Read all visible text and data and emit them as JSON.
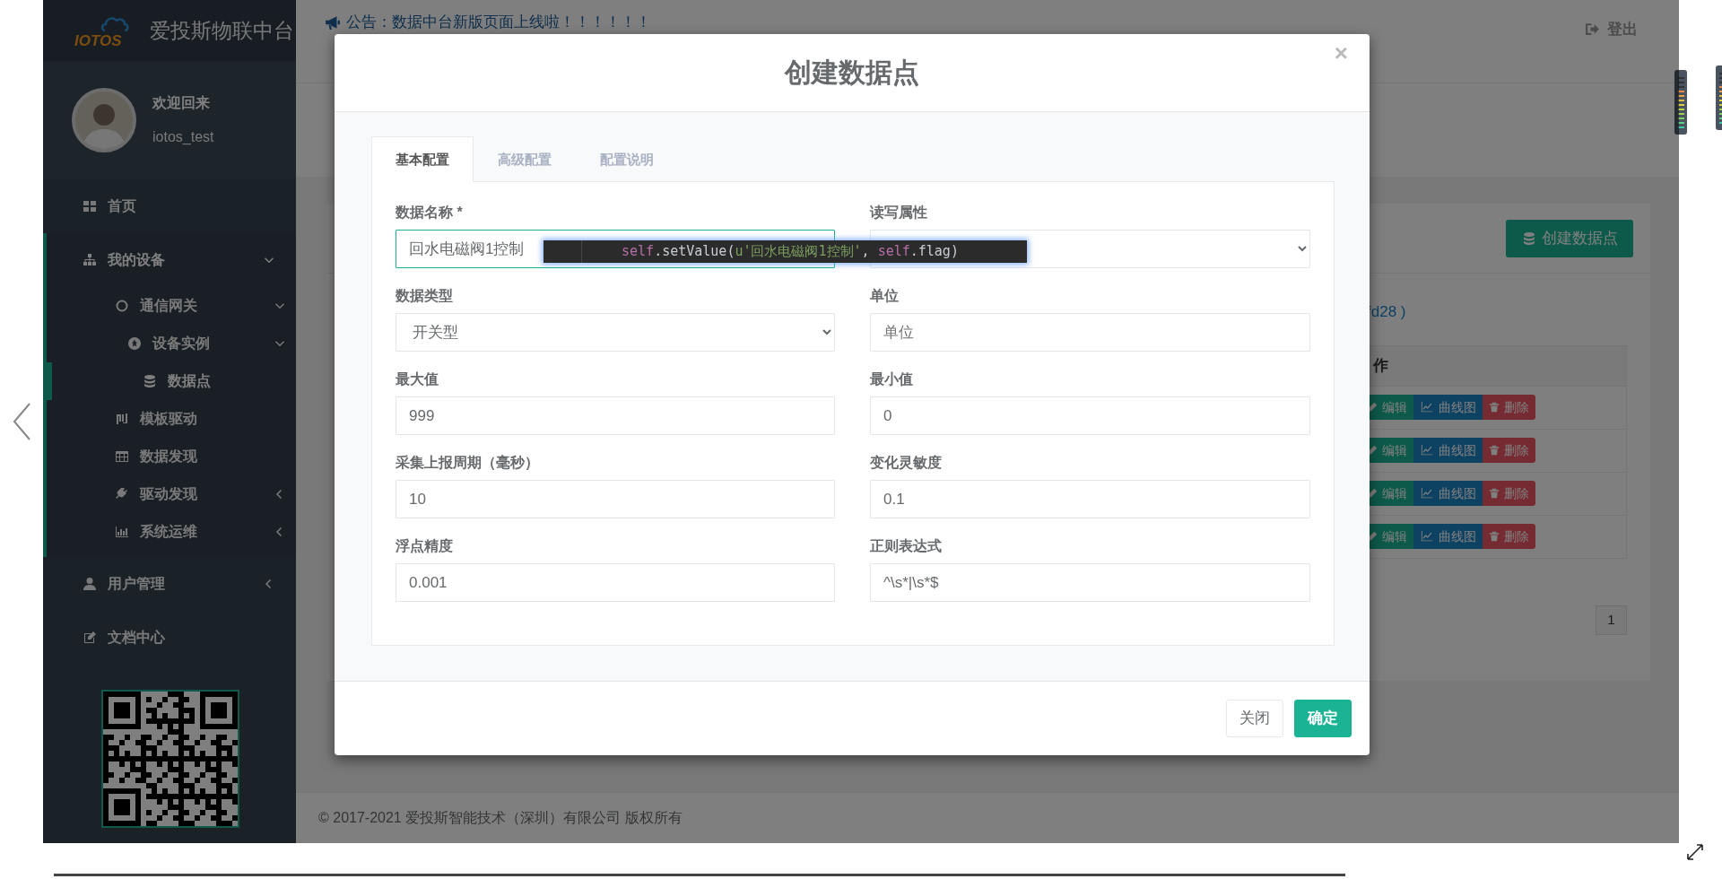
{
  "sidebar": {
    "logo_text": "IOTOS",
    "title": "爱投斯物联中台",
    "greeting": "欢迎回来",
    "username": "iotos_test",
    "menu": [
      {
        "label": "首页",
        "selected": false
      },
      {
        "label": "我的设备",
        "selected": true,
        "expanded": true,
        "children": [
          {
            "label": "通信网关",
            "selected": false,
            "expanded": true,
            "children": [
              {
                "label": "设备实例",
                "selected": false,
                "expanded": true,
                "children": [
                  {
                    "label": "数据点",
                    "selected": true
                  }
                ]
              }
            ]
          },
          {
            "label": "模板驱动",
            "selected": false
          },
          {
            "label": "数据发现",
            "selected": false
          },
          {
            "label": "驱动发现",
            "selected": false,
            "expanded": false
          },
          {
            "label": "系统运维",
            "selected": false,
            "expanded": false
          }
        ]
      },
      {
        "label": "用户管理",
        "selected": false,
        "expanded": false
      },
      {
        "label": "文档中心",
        "selected": false
      }
    ]
  },
  "header": {
    "announcement": "公告：数据中台新版页面上线啦！！！！！！",
    "logout": "登出"
  },
  "background_card": {
    "create_button": "创建数据点",
    "info_text": "fd28 )",
    "table": {
      "action_header": "作",
      "rows": [
        {
          "edit": "编辑",
          "chart": "曲线图",
          "delete": "删除"
        },
        {
          "edit": "编辑",
          "chart": "曲线图",
          "delete": "删除"
        },
        {
          "edit": "编辑",
          "chart": "曲线图",
          "delete": "删除"
        },
        {
          "edit": "编辑",
          "chart": "曲线图",
          "delete": "删除"
        }
      ]
    },
    "pages": [
      "1"
    ]
  },
  "footer": "© 2017-2021 爱投斯智能技术（深圳）有限公司 版权所有",
  "modal": {
    "title": "创建数据点",
    "close": "×",
    "tabs": [
      {
        "label": "基本配置",
        "selected": true
      },
      {
        "label": "高级配置",
        "selected": false
      },
      {
        "label": "配置说明",
        "selected": false
      }
    ],
    "fields": [
      {
        "label": "数据名称 *",
        "kind": "input",
        "value": "回水电磁阀1控制",
        "focused": true
      },
      {
        "label": "读写属性",
        "kind": "select",
        "focused": false
      },
      {
        "label": "数据类型",
        "kind": "select",
        "value": "开关型",
        "focused": false
      },
      {
        "label": "单位",
        "kind": "input",
        "placeholder": "单位",
        "focused": false
      },
      {
        "label": "最大值",
        "kind": "input",
        "value": "999",
        "focused": false
      },
      {
        "label": "最小值",
        "kind": "input",
        "value": "0",
        "focused": false
      },
      {
        "label": "采集上报周期（毫秒）",
        "kind": "input",
        "value": "10",
        "focused": false
      },
      {
        "label": "变化灵敏度",
        "kind": "input",
        "value": "0.1",
        "focused": false
      },
      {
        "label": "浮点精度",
        "kind": "input",
        "value": "0.001",
        "focused": false
      },
      {
        "label": "正则表达式",
        "kind": "input",
        "value": "^\\s*|\\s*$",
        "focused": false
      }
    ],
    "buttons": [
      {
        "label": "关闭",
        "kind": "secondary"
      },
      {
        "label": "确定",
        "kind": "primary"
      }
    ],
    "code_tooltip": {
      "tokens": [
        {
          "text": "self",
          "kind": "keyword"
        },
        {
          "text": ".setValue(",
          "kind": "plain"
        },
        {
          "text": "u'回水电磁阀1控制'",
          "kind": "string"
        },
        {
          "text": ", ",
          "kind": "plain"
        },
        {
          "text": "self",
          "kind": "keyword"
        },
        {
          "text": ".flag)",
          "kind": "plain"
        }
      ]
    }
  }
}
